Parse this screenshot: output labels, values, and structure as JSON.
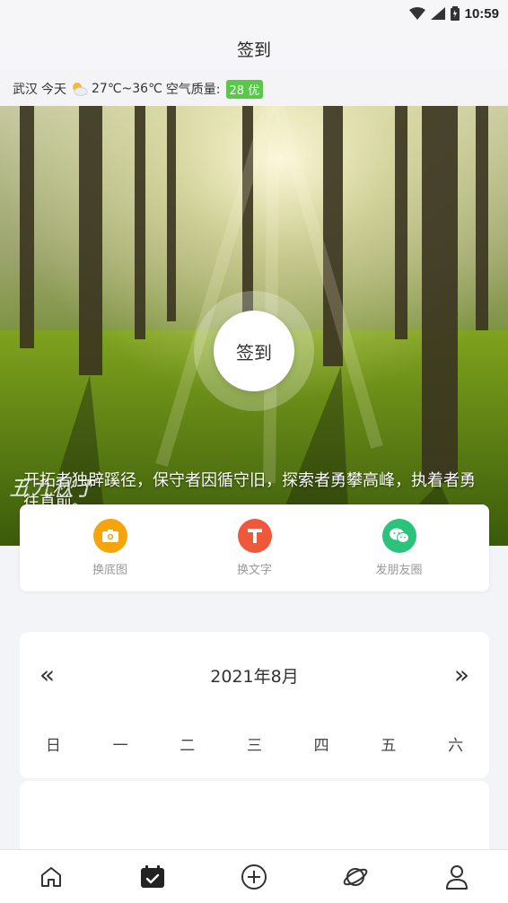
{
  "status": {
    "time": "10:59"
  },
  "header": {
    "title": "签到"
  },
  "weather": {
    "city": "武汉",
    "day": "今天",
    "temp": "27℃~36℃",
    "aqi_label": "空气质量:",
    "aqi_value": "28 优",
    "icon": "partly-cloudy-icon"
  },
  "hero": {
    "checkin_label": "签到",
    "date_script": "五九秋丁",
    "quote": "开拓者独辟蹊径，保守者因循守旧，探索者勇攀高峰，执着者勇往直前。"
  },
  "actions": [
    {
      "label": "换底图",
      "icon": "camera-icon",
      "color": "#f5a50b"
    },
    {
      "label": "换文字",
      "icon": "text-icon",
      "color": "#f0583c"
    },
    {
      "label": "发朋友圈",
      "icon": "wechat-moments-icon",
      "color": "#2bc27c"
    }
  ],
  "calendar": {
    "prev": "«",
    "next": "»",
    "month": "2021年8月",
    "weekdays": [
      "日",
      "一",
      "二",
      "三",
      "四",
      "五",
      "六"
    ]
  },
  "tabs": [
    {
      "icon": "home-icon"
    },
    {
      "icon": "calendar-check-icon",
      "active": true
    },
    {
      "icon": "add-circle-icon"
    },
    {
      "icon": "planet-icon"
    },
    {
      "icon": "user-icon"
    }
  ]
}
